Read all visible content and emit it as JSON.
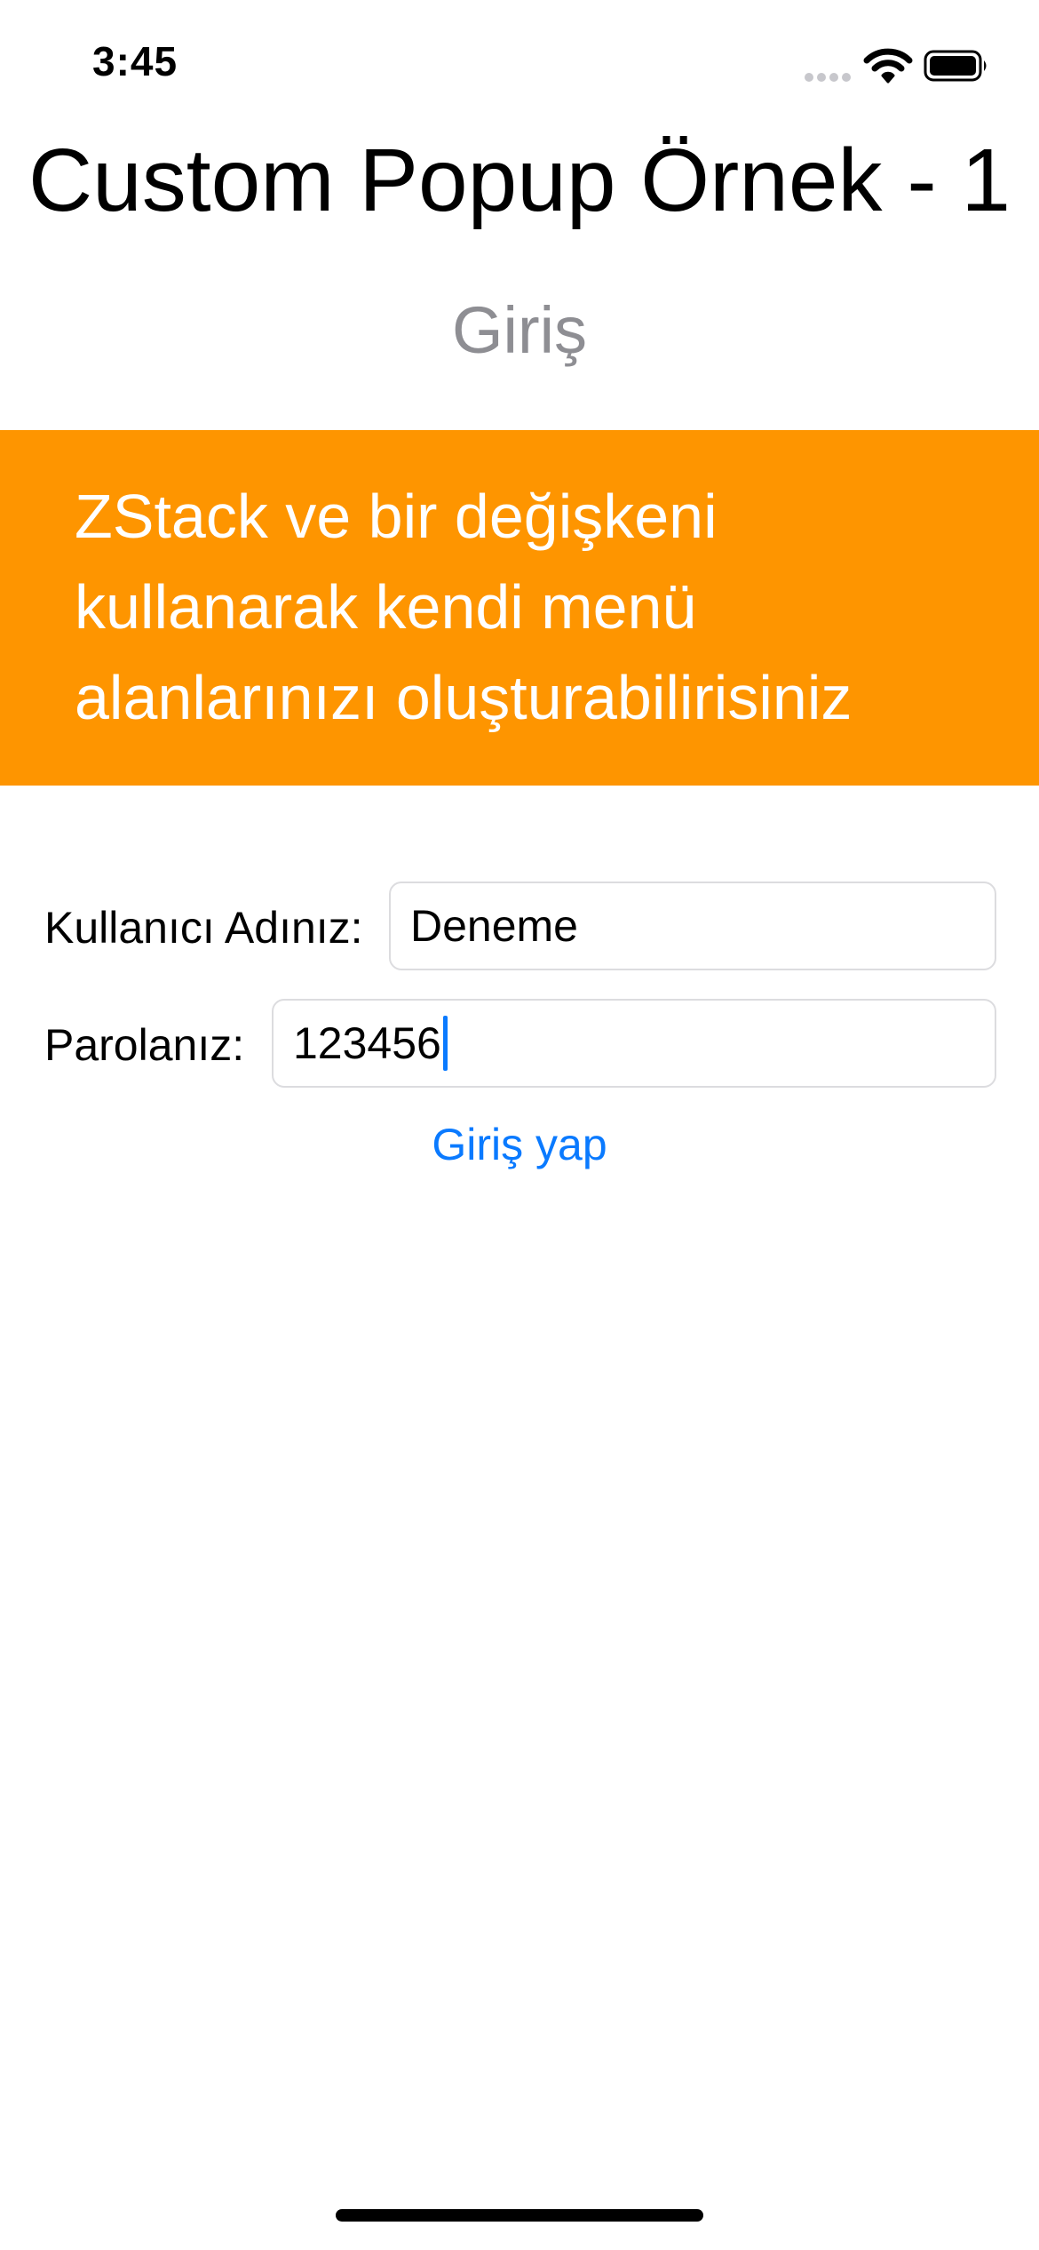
{
  "status_bar": {
    "time": "3:45",
    "icons": [
      "signal-icon",
      "wifi-icon",
      "battery-icon"
    ]
  },
  "header": {
    "title": "Custom Popup Örnek - 1",
    "subtitle": "Giriş"
  },
  "banner": {
    "text": "ZStack ve bir değişkeni kullanarak kendi menü alanlarınızı oluşturabilirisiniz",
    "background_color": "#fe9500",
    "text_color": "#ffffff"
  },
  "form": {
    "username_label": "Kullanıcı Adınız:",
    "username_value": "Deneme",
    "password_label": "Parolanız:",
    "password_value": "123456",
    "submit_label": "Giriş yap",
    "accent_color": "#0a7aff"
  }
}
